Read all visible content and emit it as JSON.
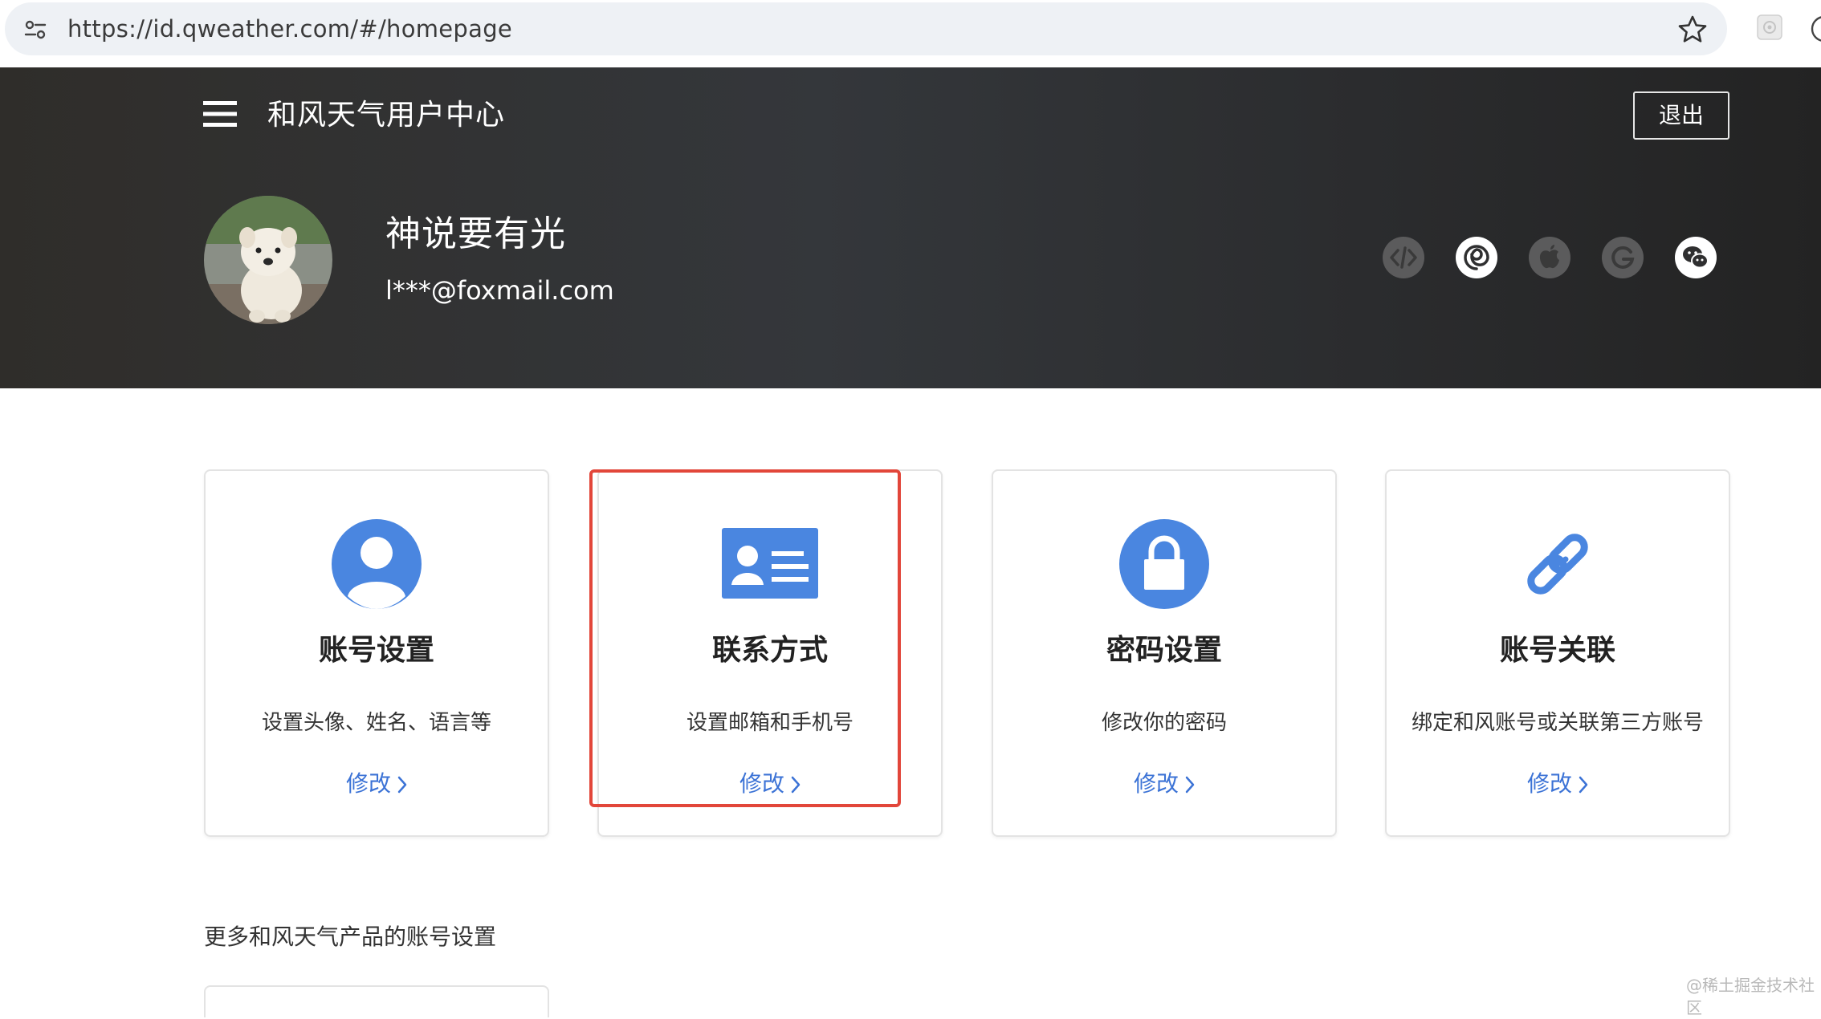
{
  "browser": {
    "url": "https://id.qweather.com/#/homepage"
  },
  "header": {
    "site_title": "和风天气用户中心",
    "logout_label": "退出",
    "user": {
      "name": "神说要有光",
      "email": "l***@foxmail.com"
    },
    "linked_accounts": [
      {
        "icon": "developer-code-icon",
        "active": false
      },
      {
        "icon": "qweather-swirl-icon",
        "active": true
      },
      {
        "icon": "apple-icon",
        "active": false
      },
      {
        "icon": "google-icon",
        "active": false
      },
      {
        "icon": "wechat-icon",
        "active": true
      }
    ]
  },
  "cards": [
    {
      "icon": "user-avatar-icon",
      "title": "账号设置",
      "description": "设置头像、姓名、语言等",
      "link": "修改"
    },
    {
      "icon": "contact-card-icon",
      "title": "联系方式",
      "description": "设置邮箱和手机号",
      "link": "修改"
    },
    {
      "icon": "lock-icon",
      "title": "密码设置",
      "description": "修改你的密码",
      "link": "修改"
    },
    {
      "icon": "link-chain-icon",
      "title": "账号关联",
      "description": "绑定和风账号或关联第三方账号",
      "link": "修改"
    }
  ],
  "more_section": {
    "title": "更多和风天气产品的账号设置"
  },
  "watermark": "@稀土掘金技术社区",
  "colors": {
    "accent_blue": "#3c73d6",
    "icon_blue": "#4a86e0",
    "highlight_red": "#e2463a",
    "header_dark": "#2f2f30"
  }
}
